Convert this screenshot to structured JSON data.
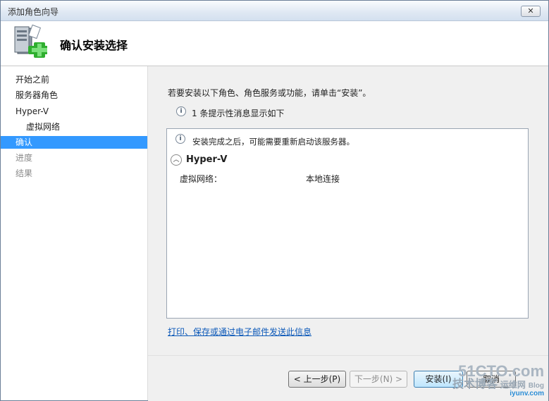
{
  "window": {
    "title": "添加角色向导",
    "close_glyph": "✕"
  },
  "header": {
    "title": "确认安装选择",
    "icon": "server-add-icon"
  },
  "nav": {
    "items": [
      {
        "label": "开始之前",
        "state": "normal"
      },
      {
        "label": "服务器角色",
        "state": "normal"
      },
      {
        "label": "Hyper-V",
        "state": "normal"
      },
      {
        "label": "虚拟网络",
        "state": "sub"
      },
      {
        "label": "确认",
        "state": "active"
      },
      {
        "label": "进度",
        "state": "disabled"
      },
      {
        "label": "结果",
        "state": "disabled"
      }
    ]
  },
  "content": {
    "intro": "若要安装以下角色、角色服务或功能，请单击“安装”。",
    "notice": "1 条提示性消息显示如下",
    "panel": {
      "notice": "安装完成之后，可能需要重新启动该服务器。",
      "section_title": "Hyper-V",
      "key": "虚拟网络：",
      "value": "本地连接"
    },
    "link": "打印、保存或通过电子邮件发送此信息"
  },
  "footer": {
    "prev": "< 上一步(P)",
    "next": "下一步(N) >",
    "install": "安装(I)",
    "cancel": "取消"
  },
  "watermark": {
    "line1": "51CTO.com",
    "line2": "技术博客",
    "line3": "运维网",
    "line4": "Blog",
    "line5": "iyunv.com"
  },
  "colors": {
    "accent": "#3399ff",
    "link": "#0b58b8"
  }
}
